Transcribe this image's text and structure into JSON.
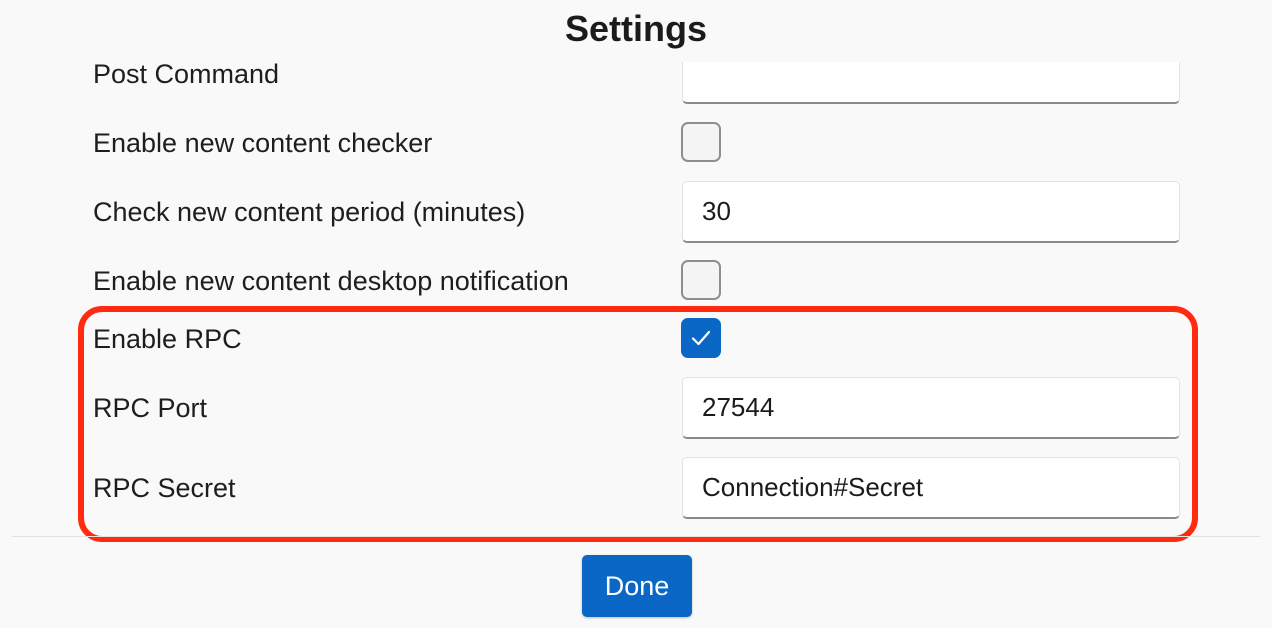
{
  "dialog": {
    "title": "Settings",
    "done_label": "Done"
  },
  "settings": {
    "post_command": {
      "label": "Post Command",
      "value": ""
    },
    "new_content_checker": {
      "label": "Enable new content checker",
      "checked": false
    },
    "check_period": {
      "label": "Check new content period (minutes)",
      "value": "30"
    },
    "desktop_notification": {
      "label": "Enable new content desktop notification",
      "checked": false
    },
    "enable_rpc": {
      "label": "Enable RPC",
      "checked": true
    },
    "rpc_port": {
      "label": "RPC Port",
      "value": "27544"
    },
    "rpc_secret": {
      "label": "RPC Secret",
      "value": "Connection#Secret"
    }
  },
  "colors": {
    "accent": "#0b67c5",
    "highlight": "#ff2a10"
  },
  "icons": {
    "checkmark": "check-icon"
  }
}
